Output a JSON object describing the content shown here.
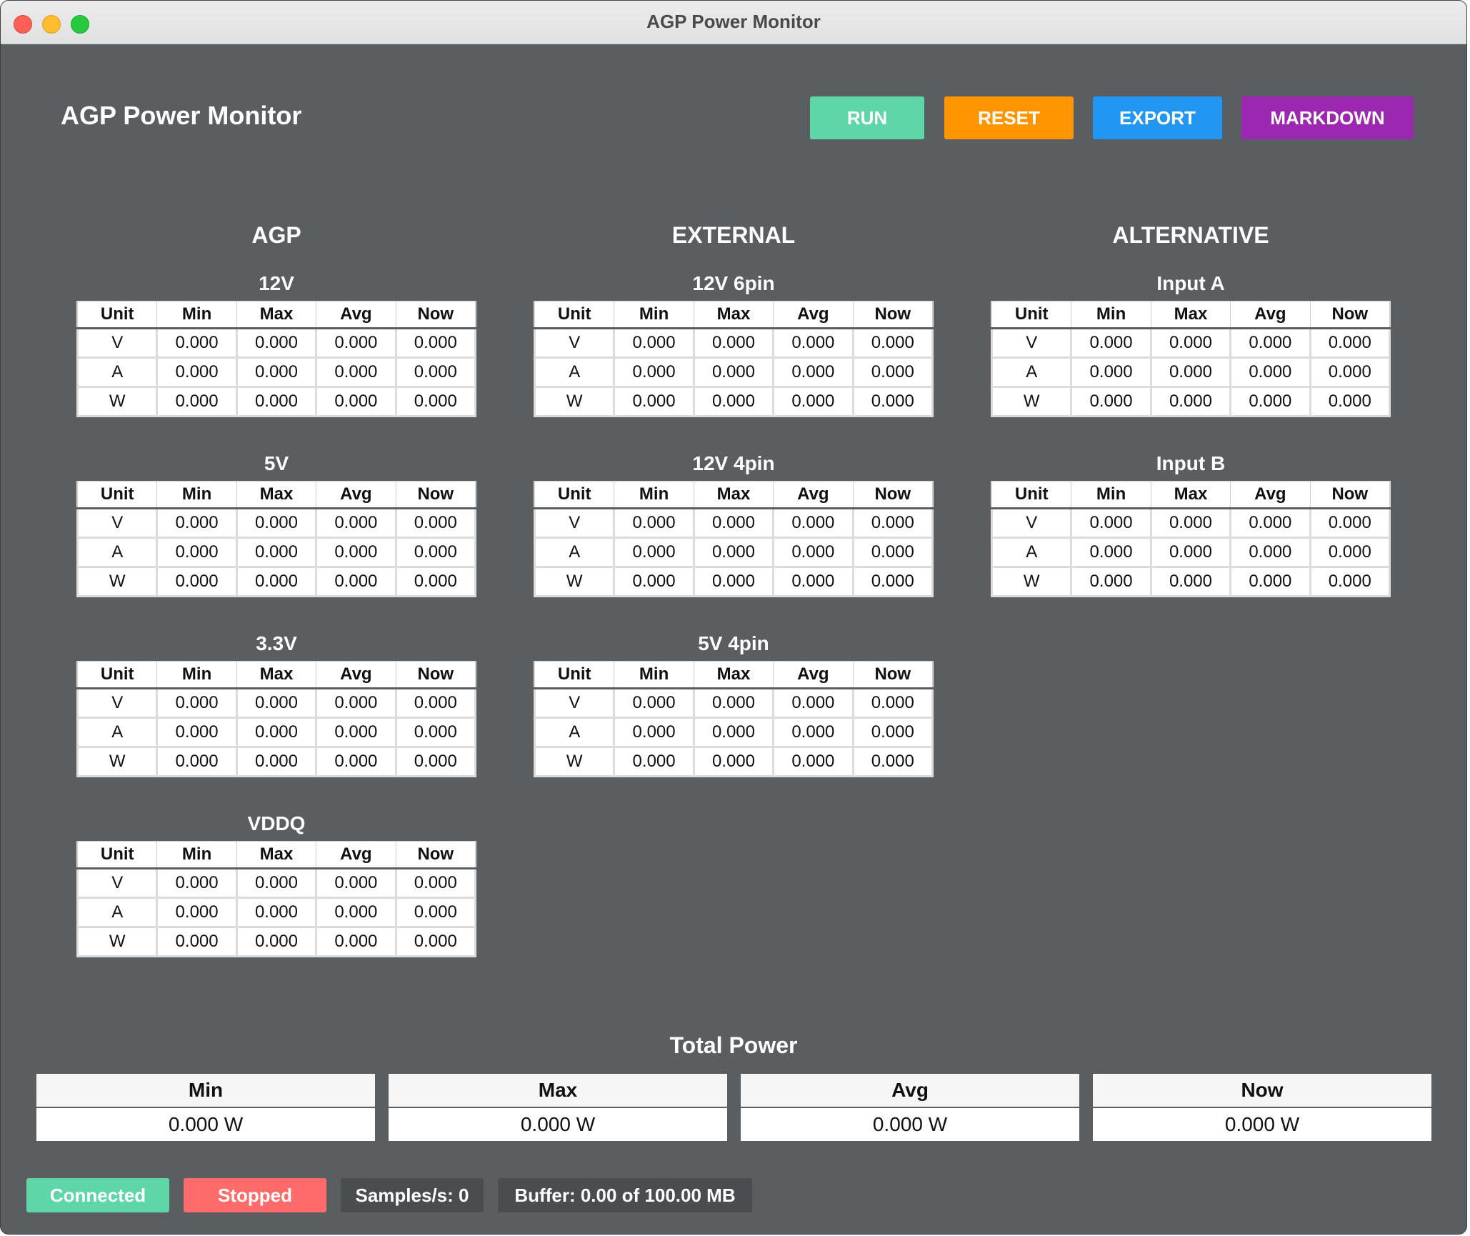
{
  "window": {
    "title": "AGP Power Monitor"
  },
  "header": {
    "title": "AGP Power Monitor",
    "buttons": {
      "run": "RUN",
      "reset": "RESET",
      "export": "EXPORT",
      "markdown": "MARKDOWN"
    },
    "button_colors": {
      "run": "#5fd6a7",
      "reset": "#ff9500",
      "export": "#2196f3",
      "markdown": "#9c27b0"
    }
  },
  "table_headers": [
    "Unit",
    "Min",
    "Max",
    "Avg",
    "Now"
  ],
  "columns": [
    {
      "title": "AGP",
      "sections": [
        {
          "title": "12V",
          "rows": [
            [
              "V",
              "0.000",
              "0.000",
              "0.000",
              "0.000"
            ],
            [
              "A",
              "0.000",
              "0.000",
              "0.000",
              "0.000"
            ],
            [
              "W",
              "0.000",
              "0.000",
              "0.000",
              "0.000"
            ]
          ]
        },
        {
          "title": "5V",
          "rows": [
            [
              "V",
              "0.000",
              "0.000",
              "0.000",
              "0.000"
            ],
            [
              "A",
              "0.000",
              "0.000",
              "0.000",
              "0.000"
            ],
            [
              "W",
              "0.000",
              "0.000",
              "0.000",
              "0.000"
            ]
          ]
        },
        {
          "title": "3.3V",
          "rows": [
            [
              "V",
              "0.000",
              "0.000",
              "0.000",
              "0.000"
            ],
            [
              "A",
              "0.000",
              "0.000",
              "0.000",
              "0.000"
            ],
            [
              "W",
              "0.000",
              "0.000",
              "0.000",
              "0.000"
            ]
          ]
        },
        {
          "title": "VDDQ",
          "rows": [
            [
              "V",
              "0.000",
              "0.000",
              "0.000",
              "0.000"
            ],
            [
              "A",
              "0.000",
              "0.000",
              "0.000",
              "0.000"
            ],
            [
              "W",
              "0.000",
              "0.000",
              "0.000",
              "0.000"
            ]
          ]
        }
      ]
    },
    {
      "title": "EXTERNAL",
      "sections": [
        {
          "title": "12V 6pin",
          "rows": [
            [
              "V",
              "0.000",
              "0.000",
              "0.000",
              "0.000"
            ],
            [
              "A",
              "0.000",
              "0.000",
              "0.000",
              "0.000"
            ],
            [
              "W",
              "0.000",
              "0.000",
              "0.000",
              "0.000"
            ]
          ]
        },
        {
          "title": "12V 4pin",
          "rows": [
            [
              "V",
              "0.000",
              "0.000",
              "0.000",
              "0.000"
            ],
            [
              "A",
              "0.000",
              "0.000",
              "0.000",
              "0.000"
            ],
            [
              "W",
              "0.000",
              "0.000",
              "0.000",
              "0.000"
            ]
          ]
        },
        {
          "title": "5V 4pin",
          "rows": [
            [
              "V",
              "0.000",
              "0.000",
              "0.000",
              "0.000"
            ],
            [
              "A",
              "0.000",
              "0.000",
              "0.000",
              "0.000"
            ],
            [
              "W",
              "0.000",
              "0.000",
              "0.000",
              "0.000"
            ]
          ]
        }
      ]
    },
    {
      "title": "ALTERNATIVE",
      "sections": [
        {
          "title": "Input A",
          "rows": [
            [
              "V",
              "0.000",
              "0.000",
              "0.000",
              "0.000"
            ],
            [
              "A",
              "0.000",
              "0.000",
              "0.000",
              "0.000"
            ],
            [
              "W",
              "0.000",
              "0.000",
              "0.000",
              "0.000"
            ]
          ]
        },
        {
          "title": "Input B",
          "rows": [
            [
              "V",
              "0.000",
              "0.000",
              "0.000",
              "0.000"
            ],
            [
              "A",
              "0.000",
              "0.000",
              "0.000",
              "0.000"
            ],
            [
              "W",
              "0.000",
              "0.000",
              "0.000",
              "0.000"
            ]
          ]
        }
      ]
    }
  ],
  "total_power": {
    "title": "Total Power",
    "cards": [
      {
        "label": "Min",
        "value": "0.000 W"
      },
      {
        "label": "Max",
        "value": "0.000 W"
      },
      {
        "label": "Avg",
        "value": "0.000 W"
      },
      {
        "label": "Now",
        "value": "0.000 W"
      }
    ]
  },
  "status_bar": {
    "connected": "Connected",
    "stopped": "Stopped",
    "samples": "Samples/s: 0",
    "buffer": "Buffer: 0.00 of 100.00 MB",
    "colors": {
      "connected": "#5fd6a7",
      "stopped": "#ff6b6b",
      "info": "#4a4d50"
    }
  }
}
